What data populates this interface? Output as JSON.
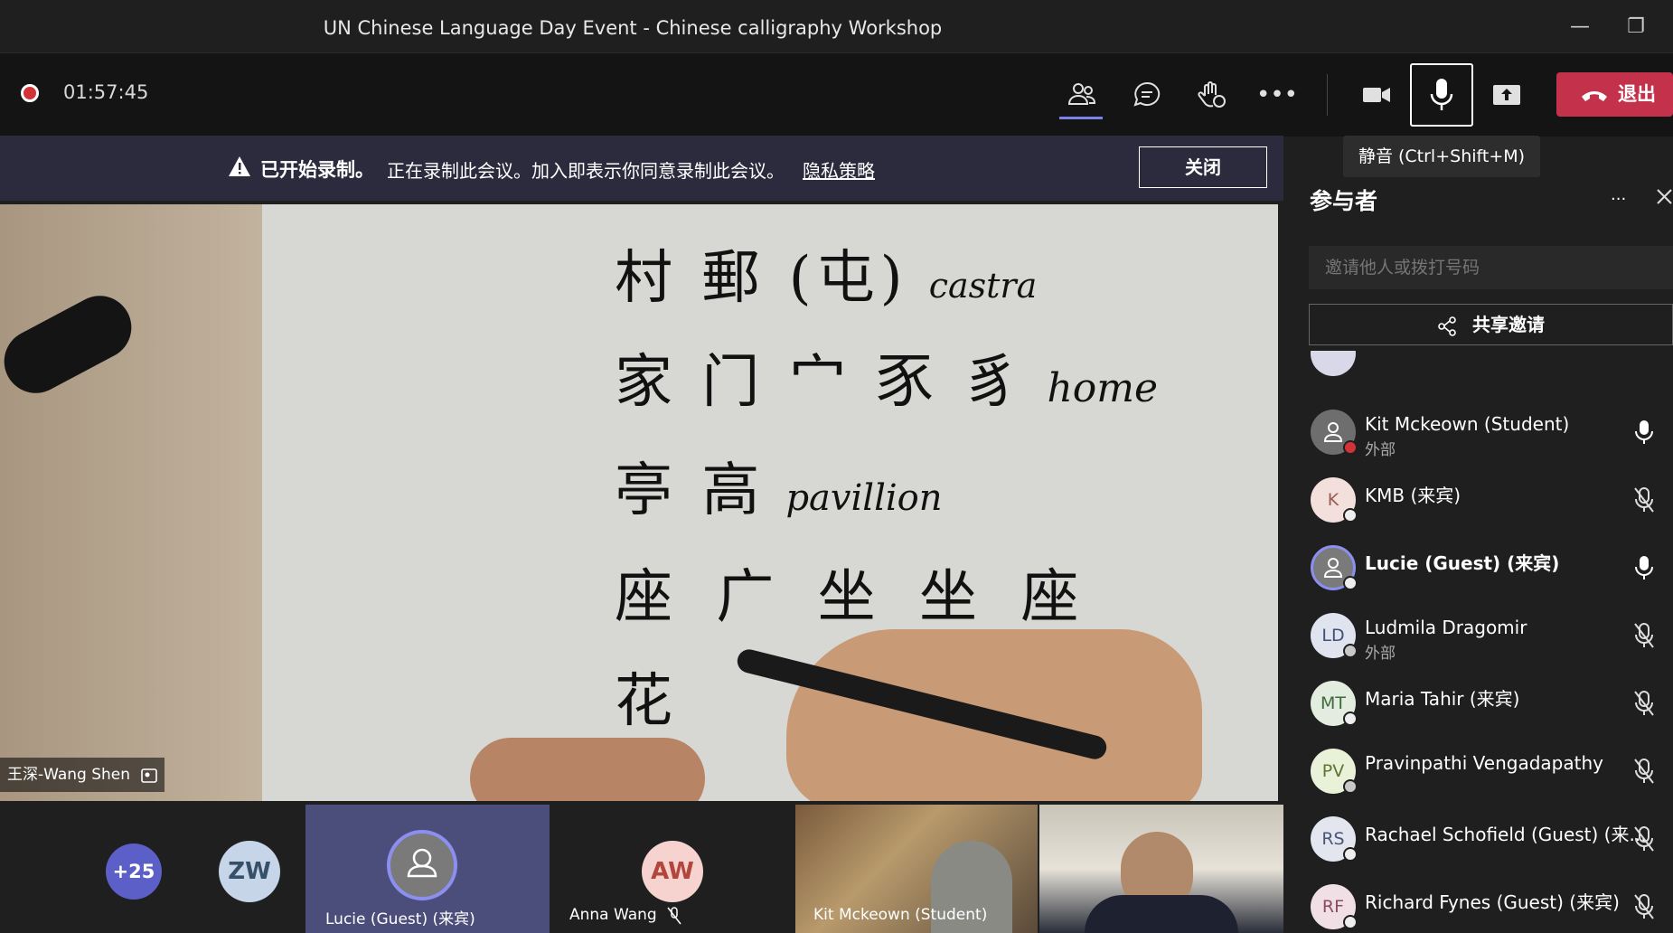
{
  "window": {
    "title": "UN Chinese Language Day Event - Chinese calligraphy Workshop",
    "minimize": "—",
    "restore": "❐"
  },
  "toolbar": {
    "timer": "01:57:45",
    "leave_label": "退出",
    "mic_tooltip": "静音 (Ctrl+Shift+M)"
  },
  "banner": {
    "title": "已开始录制。",
    "message": "正在录制此会议。加入即表示你同意录制此会议。",
    "link": "隐私策略",
    "close_label": "关闭"
  },
  "video": {
    "speaker_label": "王深-Wang Shen",
    "lines": [
      {
        "chars": "村 郵 (屯)",
        "word": "castra"
      },
      {
        "chars": "家 门 宀 豕 豸",
        "word": "home"
      },
      {
        "chars": "亭 高",
        "word": "pavillion"
      },
      {
        "chars": "座 广 坐 坐 座",
        "word": ""
      },
      {
        "chars": "花",
        "word": ""
      }
    ]
  },
  "strip": {
    "overflow_count": "+25",
    "tiles": [
      {
        "initials": "ZW",
        "name": ""
      },
      {
        "initials": "",
        "name": "Lucie (Guest) (来宾)"
      },
      {
        "initials": "AW",
        "name": "Anna Wang"
      },
      {
        "initials": "",
        "name": "Kit Mckeown (Student)"
      },
      {
        "initials": "",
        "name": ""
      }
    ]
  },
  "panel": {
    "title": "参与者",
    "more": "···",
    "invite_placeholder": "邀请他人或拨打号码",
    "share_label": "共享邀请",
    "participants": [
      {
        "initials": "",
        "name": "Kit Mckeown (Student)",
        "sub": "外部",
        "mic": "on",
        "status": "red"
      },
      {
        "initials": "K",
        "name": "KMB (来宾)",
        "sub": "",
        "mic": "off",
        "status": "white"
      },
      {
        "initials": "",
        "name": "Lucie (Guest) (来宾)",
        "sub": "",
        "mic": "on",
        "status": "white"
      },
      {
        "initials": "LD",
        "name": "Ludmila Dragomir",
        "sub": "外部",
        "mic": "off",
        "status": "gray"
      },
      {
        "initials": "MT",
        "name": "Maria Tahir (来宾)",
        "sub": "",
        "mic": "off",
        "status": "white"
      },
      {
        "initials": "PV",
        "name": "Pravinpathi Vengadapathy",
        "sub": "",
        "mic": "off",
        "status": "gray"
      },
      {
        "initials": "RS",
        "name": "Rachael Schofield (Guest) (来...",
        "sub": "",
        "mic": "off",
        "status": "white"
      },
      {
        "initials": "RF",
        "name": "Richard Fynes (Guest) (来宾)",
        "sub": "",
        "mic": "off",
        "status": "white"
      }
    ]
  }
}
